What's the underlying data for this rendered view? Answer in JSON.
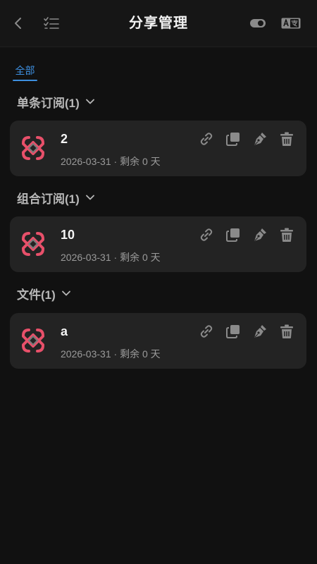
{
  "header": {
    "title": "分享管理",
    "icons": [
      "chevron-left-icon",
      "checklist-icon",
      "toggle-icon",
      "translate-icon"
    ]
  },
  "tabs": [
    {
      "label": "全部",
      "active": true
    }
  ],
  "sections": [
    {
      "title": "单条订阅(1)",
      "items": [
        {
          "name": "2",
          "date": "2026-03-31",
          "sep": "·",
          "remaining": "剩余 0 天"
        }
      ]
    },
    {
      "title": "组合订阅(1)",
      "items": [
        {
          "name": "10",
          "date": "2026-03-31",
          "sep": "·",
          "remaining": "剩余 0 天"
        }
      ]
    },
    {
      "title": "文件(1)",
      "items": [
        {
          "name": "a",
          "date": "2026-03-31",
          "sep": "·",
          "remaining": "剩余 0 天"
        }
      ]
    }
  ],
  "colors": {
    "background": "#111111",
    "card": "#232323",
    "accent": "#3d8fe0",
    "logo": "#e8506a"
  }
}
